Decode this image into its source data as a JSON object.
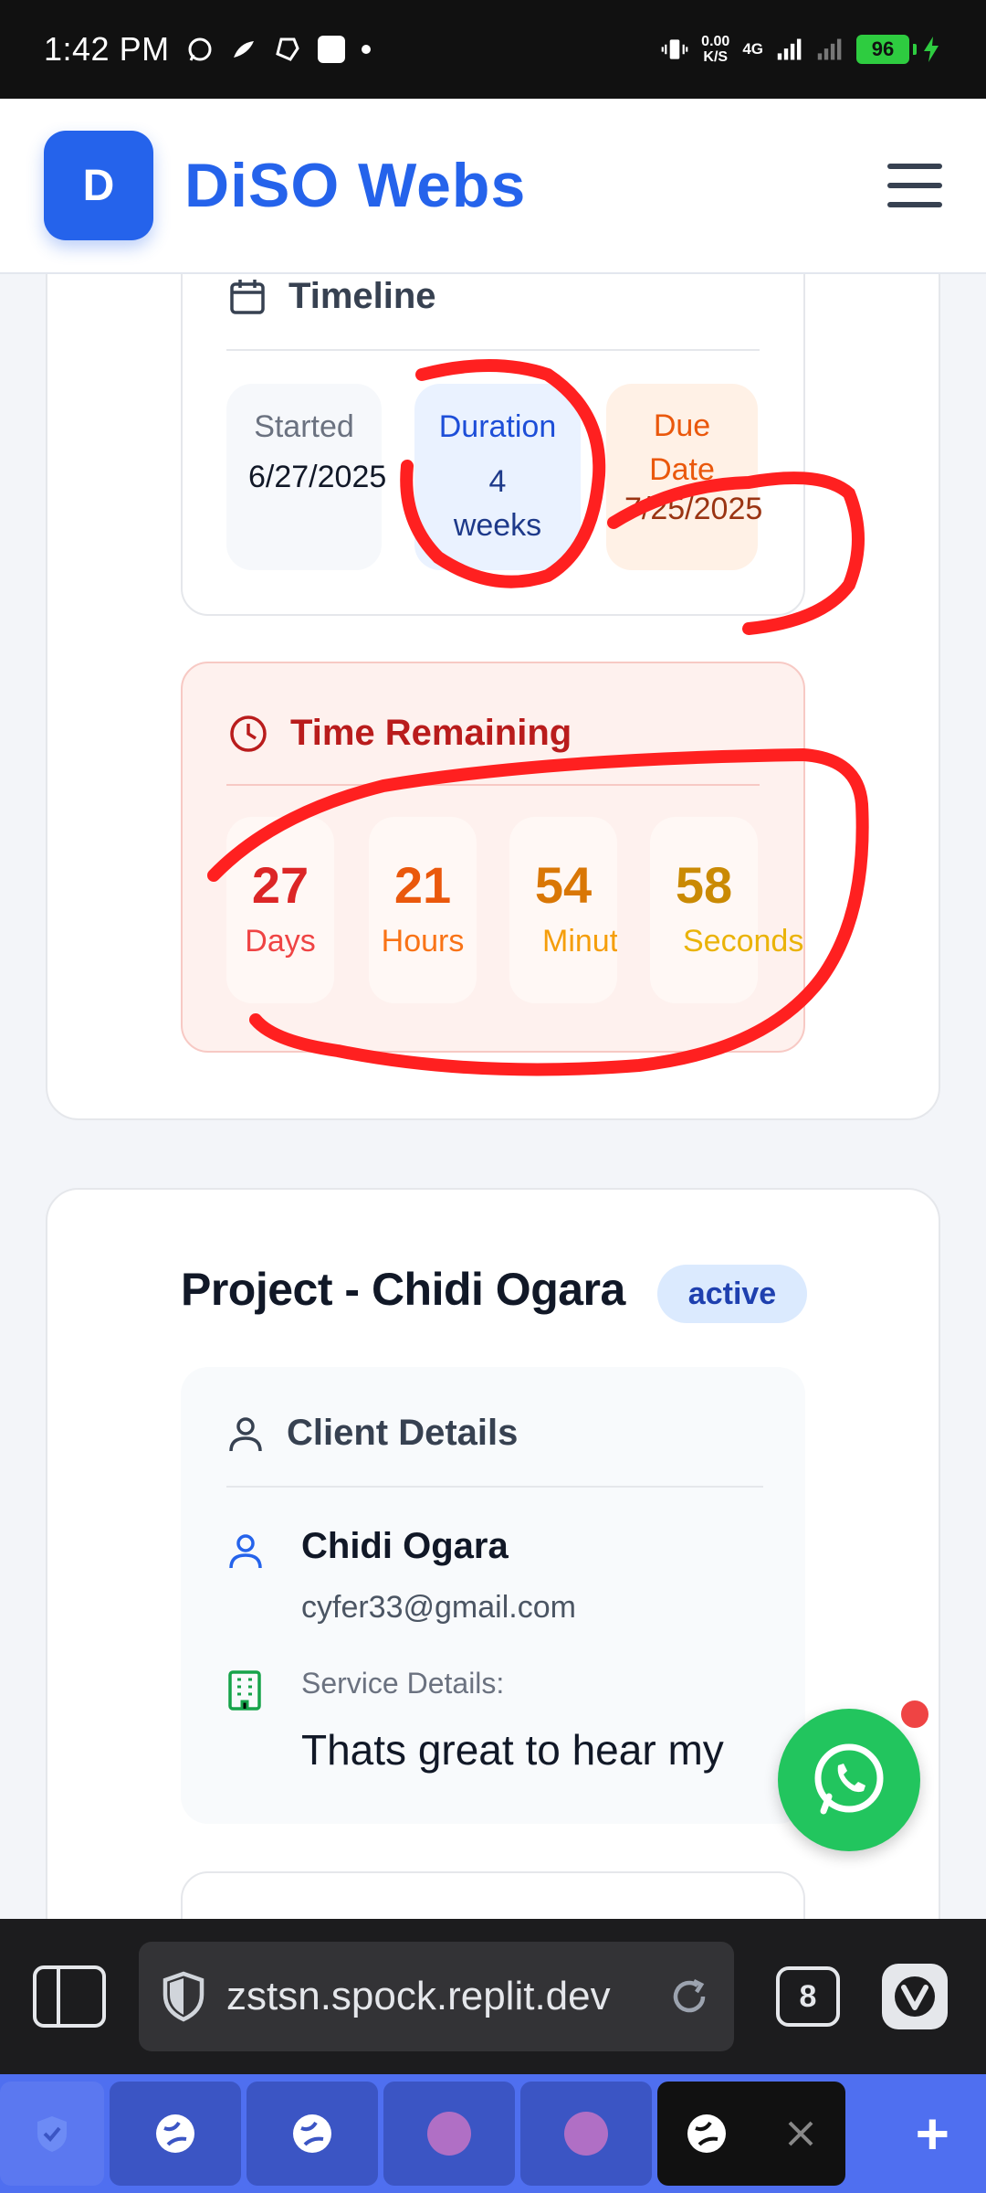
{
  "status_bar": {
    "time": "1:42 PM",
    "net_speed_value": "0.00",
    "net_speed_unit": "K/S",
    "network": "4G",
    "battery": "96"
  },
  "header": {
    "logo_letter": "D",
    "brand": "DiSO Webs"
  },
  "timeline": {
    "title": "Timeline",
    "started_label": "Started",
    "started_value": "6/27/2025",
    "duration_label": "Duration",
    "duration_value": "4 weeks",
    "due_label": "Due Date",
    "due_value": "7/25/2025"
  },
  "remaining": {
    "title": "Time Remaining",
    "days": "27",
    "days_label": "Days",
    "hours": "21",
    "hours_label": "Hours",
    "minutes": "54",
    "minutes_label": "Minutes",
    "seconds": "58",
    "seconds_label": "Seconds"
  },
  "project": {
    "title": "Project - Chidi Ogara",
    "status": "active"
  },
  "client": {
    "title": "Client Details",
    "name": "Chidi Ogara",
    "email": "cyfer33@gmail.com",
    "service_label": "Service Details:",
    "service_text": "Thats great to hear my"
  },
  "browser": {
    "url": "zstsn.spock.replit.dev",
    "tab_count": "8"
  },
  "colors": {
    "brand": "#2563eb",
    "annotation": "#ff2020",
    "whatsapp": "#22c55e",
    "tab_strip": "#4f6ff0"
  }
}
